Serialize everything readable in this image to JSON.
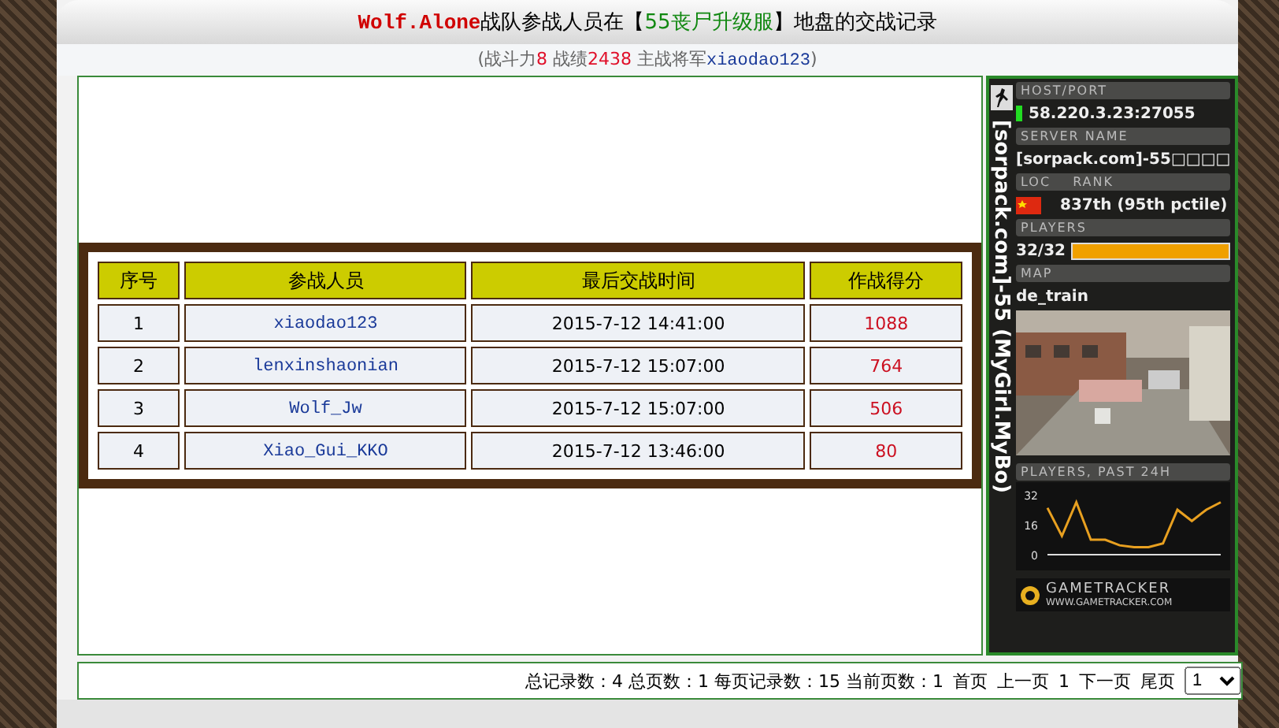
{
  "title": {
    "team": "Wolf.Alone",
    "before": "战队参战人员在【",
    "server": "55丧尸升级服",
    "after": "】地盘的交战记录"
  },
  "subtitle": {
    "open": "(战斗力",
    "power": "8",
    "mid": " 战绩",
    "record": "2438",
    "gen": " 主战将军",
    "general": "xiaodao123",
    "close": ")"
  },
  "table": {
    "columns": [
      "序号",
      "参战人员",
      "最后交战时间",
      "作战得分"
    ],
    "rows": [
      {
        "index": "1",
        "player": "xiaodao123",
        "time": "2015-7-12 14:41:00",
        "score": "1088"
      },
      {
        "index": "2",
        "player": "lenxinshaonian",
        "time": "2015-7-12 15:07:00",
        "score": "764"
      },
      {
        "index": "3",
        "player": "Wolf_Jw",
        "time": "2015-7-12 15:07:00",
        "score": "506"
      },
      {
        "index": "4",
        "player": "Xiao_Gui_KKO",
        "time": "2015-7-12 13:46:00",
        "score": "80"
      }
    ]
  },
  "server_widget": {
    "vertical_title": "[sorpack.com]-55 (MyGirl.MyBo)",
    "host_label": "HOST/PORT",
    "host": "58.220.3.23:27055",
    "name_label": "SERVER NAME",
    "name": "[sorpack.com]-55□□□□",
    "loc_label": "LOC",
    "rank_label": "RANK",
    "rank": "837th (95th pctile)",
    "players_label": "PLAYERS",
    "players": "32/32",
    "level": 1,
    "map_label": "MAP",
    "map": "de_train",
    "history_label": "PLAYERS, PAST 24H",
    "chart_data": {
      "type": "line",
      "yticks": [
        0,
        16,
        32
      ],
      "ylim": [
        0,
        32
      ],
      "series": [
        {
          "color": "#e8a020",
          "values": [
            25,
            10,
            28,
            8,
            8,
            5,
            4,
            4,
            6,
            24,
            18,
            24,
            28
          ]
        }
      ]
    },
    "brand": "GAMETRACKER",
    "url": "WWW.GAMETRACKER.COM"
  },
  "pagination": {
    "summary": "总记录数：4 总页数：1 每页记录数：15 当前页数：1",
    "links": [
      "首页",
      "上一页",
      "1",
      "下一页",
      "尾页"
    ],
    "page_select": "1"
  }
}
